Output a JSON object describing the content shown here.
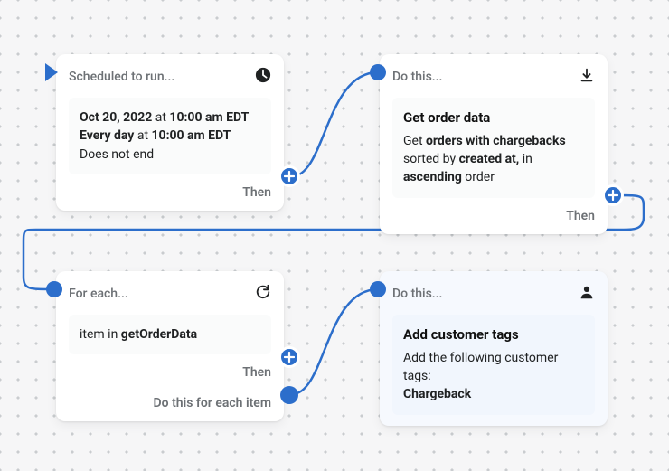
{
  "card1": {
    "header": "Scheduled to run...",
    "icon": "clock-icon",
    "line1_a": "Oct 20, 2022",
    "line1_b": " at ",
    "line1_c": "10:00 am EDT",
    "line2_a": "Every day",
    "line2_b": " at ",
    "line2_c": "10:00 am EDT",
    "line3": "Does not end",
    "then": "Then"
  },
  "card2": {
    "header": "Do this...",
    "icon": "download-icon",
    "title": "Get order data",
    "p1_a": "Get ",
    "p1_b": "orders with chargebacks",
    "p2_a": "sorted by ",
    "p2_b": "created at,",
    "p2_c": " in ",
    "p3_a": "ascending",
    "p3_b": " order",
    "then": "Then"
  },
  "card3": {
    "header": "For each...",
    "icon": "refresh-icon",
    "line_a": "item in ",
    "line_b": "getOrderData",
    "then": "Then",
    "footer": "Do this for each item"
  },
  "card4": {
    "header": "Do this...",
    "icon": "person-icon",
    "title": "Add customer tags",
    "line1": "Add the following customer tags:",
    "line2": "Chargeback"
  }
}
